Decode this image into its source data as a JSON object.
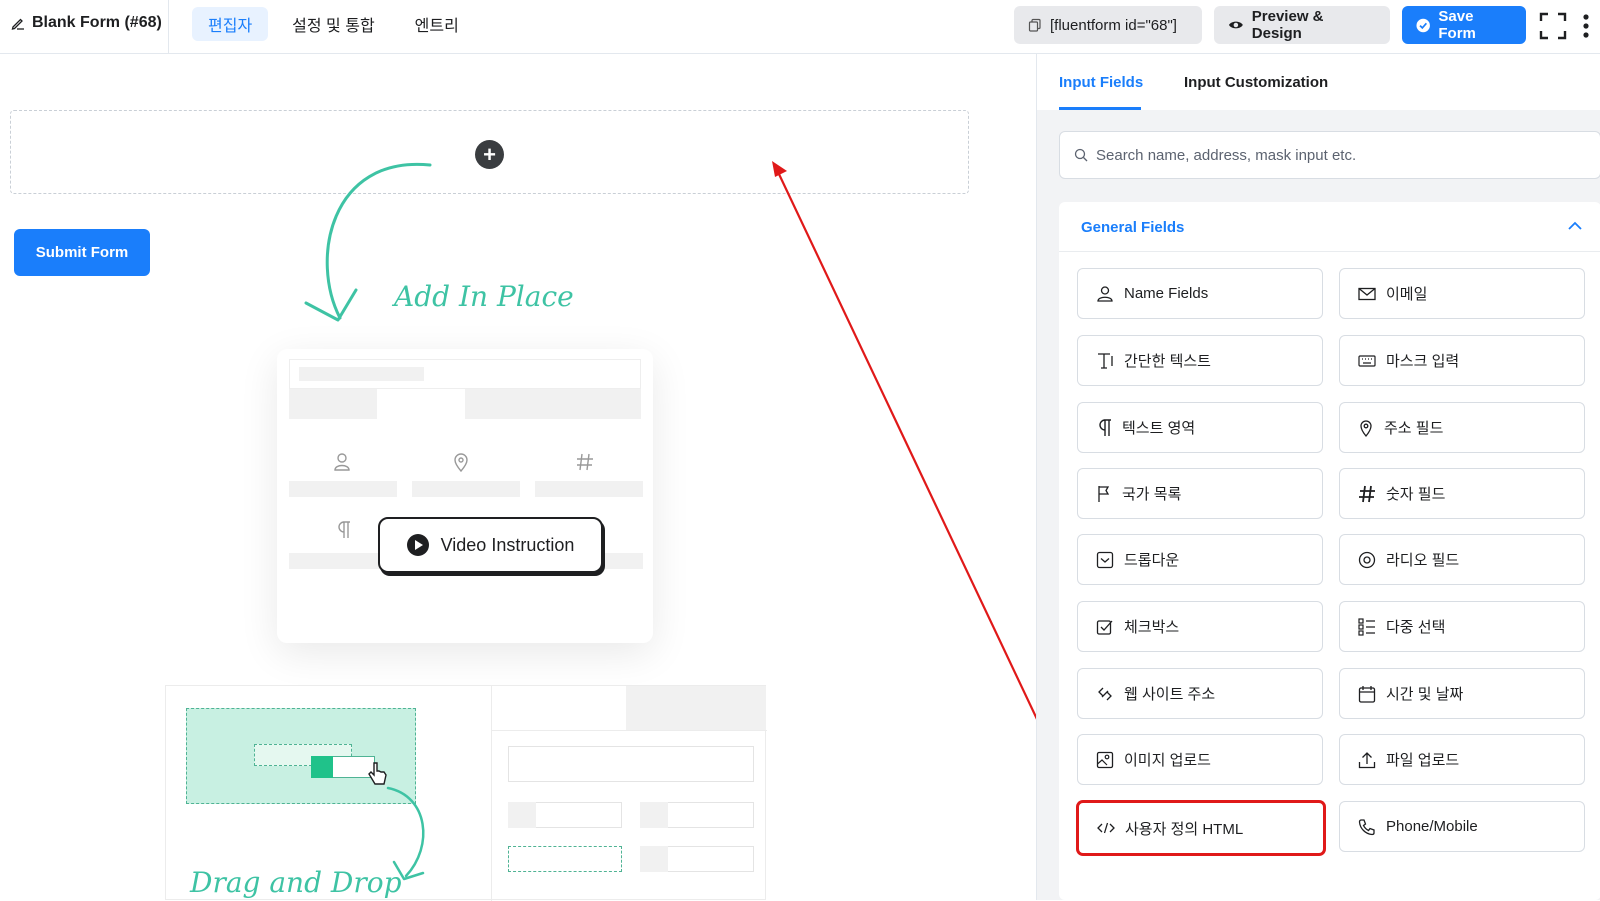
{
  "header": {
    "form_title": "Blank Form (#68)",
    "tabs": [
      {
        "label": "편집자",
        "active": true
      },
      {
        "label": "설정 및 통합",
        "active": false
      },
      {
        "label": "엔트리",
        "active": false
      }
    ],
    "shortcode": "[fluentform id=\"68\"]",
    "preview_label": "Preview & Design",
    "save_label": "Save Form"
  },
  "canvas": {
    "submit_label": "Submit Form",
    "add_in_place": "Add In Place",
    "video_instruction": "Video Instruction",
    "drag_and_drop": "Drag and Drop"
  },
  "panel": {
    "tabs": [
      {
        "label": "Input Fields",
        "active": true
      },
      {
        "label": "Input Customization",
        "active": false
      }
    ],
    "search_placeholder": "Search name, address, mask input etc.",
    "section_title": "General Fields",
    "fields": [
      {
        "label": "Name Fields",
        "icon": "user-icon"
      },
      {
        "label": "이메일",
        "icon": "envelope-icon"
      },
      {
        "label": "간단한 텍스트",
        "icon": "text-icon"
      },
      {
        "label": "마스크 입력",
        "icon": "keyboard-icon"
      },
      {
        "label": "텍스트 영역",
        "icon": "paragraph-icon"
      },
      {
        "label": "주소 필드",
        "icon": "location-pin-icon"
      },
      {
        "label": "국가 목록",
        "icon": "flag-icon"
      },
      {
        "label": "숫자 필드",
        "icon": "hash-icon"
      },
      {
        "label": "드롭다운",
        "icon": "dropdown-icon"
      },
      {
        "label": "라디오 필드",
        "icon": "radio-icon"
      },
      {
        "label": "체크박스",
        "icon": "checkbox-icon"
      },
      {
        "label": "다중 선택",
        "icon": "list-icon"
      },
      {
        "label": "웹 사이트 주소",
        "icon": "link-icon"
      },
      {
        "label": "시간 및 날짜",
        "icon": "calendar-icon"
      },
      {
        "label": "이미지 업로드",
        "icon": "image-icon"
      },
      {
        "label": "파일 업로드",
        "icon": "upload-icon"
      },
      {
        "label": "사용자 정의 HTML",
        "icon": "code-icon",
        "highlighted": true
      },
      {
        "label": "Phone/Mobile",
        "icon": "phone-icon"
      }
    ]
  },
  "colors": {
    "accent": "#1a7efb",
    "highlight": "#e01919",
    "illustration": "#3ec3a4"
  }
}
